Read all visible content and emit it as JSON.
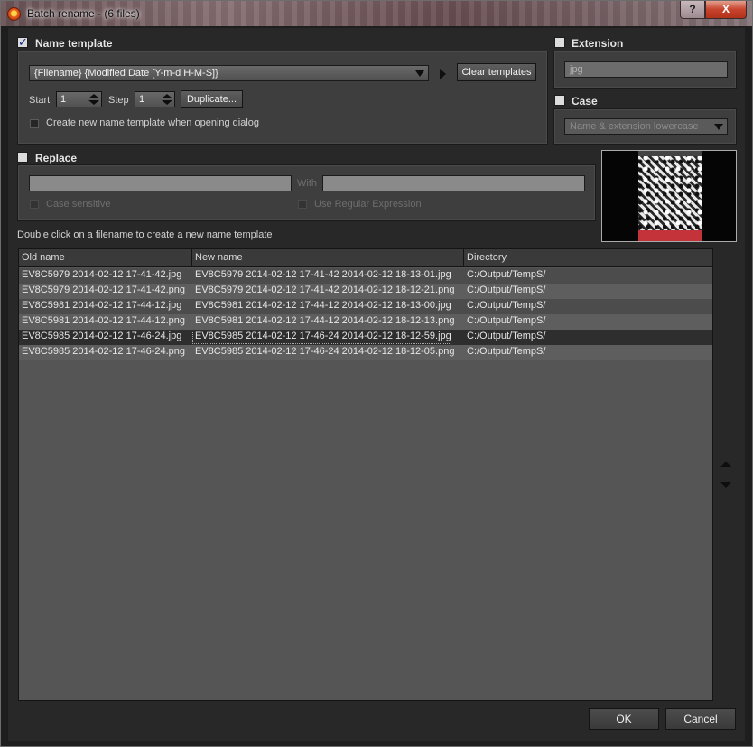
{
  "window": {
    "title": "Batch rename - (6 files)",
    "help_label": "?",
    "close_label": "X"
  },
  "name_template": {
    "label": "Name template",
    "checked": true,
    "template_value": "{Filename} {Modified Date [Y-m-d H-M-S]}",
    "clear_button": "Clear templates",
    "start_label": "Start",
    "start_value": "1",
    "step_label": "Step",
    "step_value": "1",
    "duplicate_button": "Duplicate...",
    "create_on_open_label": "Create new name template when opening dialog"
  },
  "extension": {
    "label": "Extension",
    "checked": false,
    "placeholder": "jpg"
  },
  "case": {
    "label": "Case",
    "checked": false,
    "selected": "Name & extension lowercase"
  },
  "replace": {
    "label": "Replace",
    "checked": false,
    "with_label": "With",
    "case_sensitive_label": "Case sensitive",
    "regex_label": "Use Regular Expression"
  },
  "hint": "Double click on a filename to create a new name template",
  "table": {
    "columns": [
      "Old name",
      "New name",
      "Directory"
    ],
    "rows": [
      {
        "old": "EV8C5979 2014-02-12 17-41-42.jpg",
        "new": "EV8C5979 2014-02-12 17-41-42 2014-02-12 18-13-01.jpg",
        "dir": "C:/Output/TempS/"
      },
      {
        "old": "EV8C5979 2014-02-12 17-41-42.png",
        "new": "EV8C5979 2014-02-12 17-41-42 2014-02-12 18-12-21.png",
        "dir": "C:/Output/TempS/"
      },
      {
        "old": "EV8C5981 2014-02-12 17-44-12.jpg",
        "new": "EV8C5981 2014-02-12 17-44-12 2014-02-12 18-13-00.jpg",
        "dir": "C:/Output/TempS/"
      },
      {
        "old": "EV8C5981 2014-02-12 17-44-12.png",
        "new": "EV8C5981 2014-02-12 17-44-12 2014-02-12 18-12-13.png",
        "dir": "C:/Output/TempS/"
      },
      {
        "old": "EV8C5985 2014-02-12 17-46-24.jpg",
        "new": "EV8C5985 2014-02-12 17-46-24 2014-02-12 18-12-59.jpg",
        "dir": "C:/Output/TempS/"
      },
      {
        "old": "EV8C5985 2014-02-12 17-46-24.png",
        "new": "EV8C5985 2014-02-12 17-46-24 2014-02-12 18-12-05.png",
        "dir": "C:/Output/TempS/"
      }
    ]
  },
  "buttons": {
    "ok": "OK",
    "cancel": "Cancel"
  }
}
